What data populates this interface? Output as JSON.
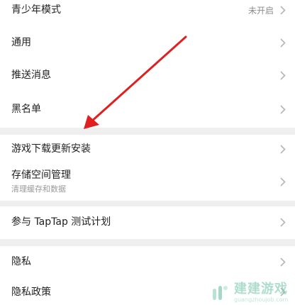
{
  "settings": {
    "youth_mode": {
      "label": "青少年模式",
      "value": "未开启"
    },
    "general": {
      "label": "通用"
    },
    "push": {
      "label": "推送消息"
    },
    "blacklist": {
      "label": "黑名单"
    },
    "game_update": {
      "label": "游戏下载更新安装"
    },
    "storage": {
      "label": "存储空间管理",
      "sublabel": "清理缓存和数据"
    },
    "test_plan": {
      "label": "参与 TapTap 测试计划"
    },
    "privacy": {
      "label": "隐私"
    },
    "privacy_policy": {
      "label": "隐私政策"
    }
  },
  "annotation": {
    "color": "#e02020",
    "points_to": "game_update"
  },
  "watermark": {
    "title": "建建游戏",
    "url": "guangzhoujob.com"
  },
  "colors": {
    "separator": "#efefef",
    "label": "#222222",
    "secondary": "#9a9a9a",
    "chevron": "#b5b5b5"
  }
}
